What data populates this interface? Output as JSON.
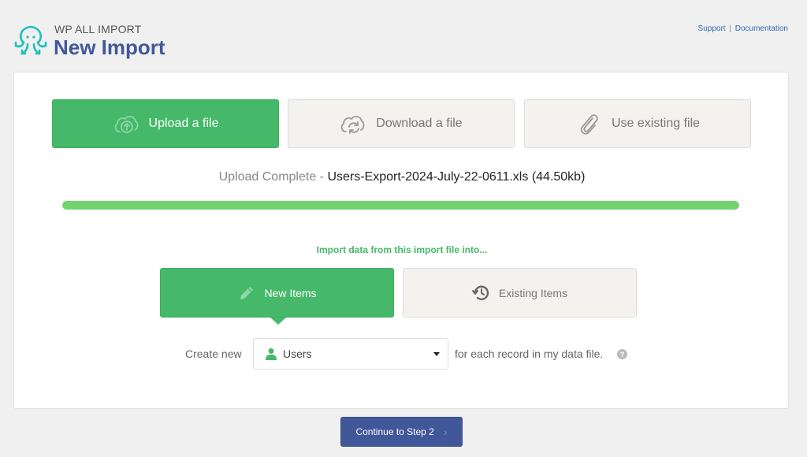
{
  "header": {
    "brand_small": "WP ALL IMPORT",
    "title": "New Import",
    "links": {
      "support": "Support",
      "separator": "|",
      "documentation": "Documentation"
    }
  },
  "source_options": [
    {
      "label": "Upload a file",
      "icon": "cloud-upload-icon",
      "active": true
    },
    {
      "label": "Download a file",
      "icon": "cloud-sync-icon",
      "active": false
    },
    {
      "label": "Use existing file",
      "icon": "paperclip-icon",
      "active": false
    }
  ],
  "upload": {
    "status": "Upload Complete",
    "separator": " - ",
    "file_name": "Users-Export-2024-July-22-0611.xls",
    "file_size": "(44.50kb)",
    "progress_percent": 100
  },
  "import_into": {
    "heading": "Import data from this import file into...",
    "options": [
      {
        "label": "New Items",
        "icon": "pencil-icon",
        "active": true
      },
      {
        "label": "Existing Items",
        "icon": "history-icon",
        "active": false
      }
    ]
  },
  "create_new": {
    "prefix": "Create new",
    "selected": "Users",
    "selected_icon": "user-icon",
    "suffix": "for each record in my data file.",
    "help": "?"
  },
  "footer": {
    "continue_label": "Continue to Step 2",
    "continue_icon": "chevron-right-icon",
    "chevron": "›"
  },
  "colors": {
    "accent_green": "#46b86a",
    "brand_blue": "#40579a",
    "progress": "#72d46f",
    "logo_teal": "#1fbfbf"
  }
}
